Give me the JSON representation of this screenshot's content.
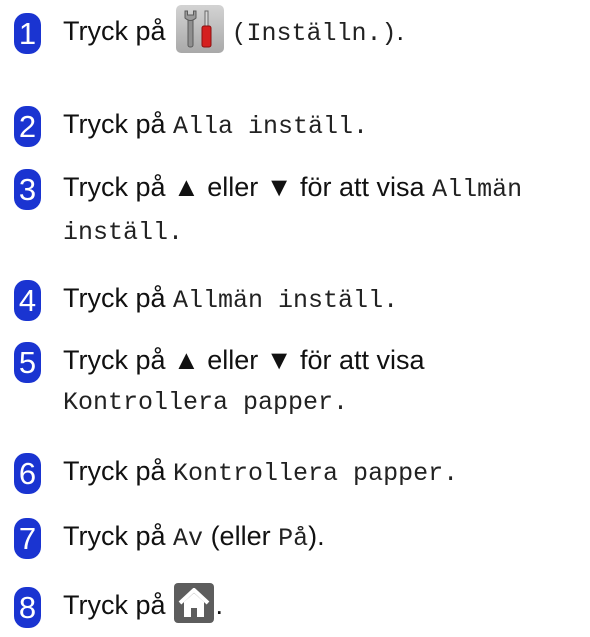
{
  "steps": [
    {
      "number": "1",
      "before": "Tryck på",
      "icon": "settings-tools-icon",
      "code": "(Inställn.)",
      "after": "."
    },
    {
      "number": "2",
      "before": "Tryck på",
      "code": "Alla inställ.",
      "after": ""
    },
    {
      "number": "3",
      "before": "Tryck på ▲ eller ▼ för att visa",
      "code1": "Allmän",
      "code2": "inställ.",
      "after": ""
    },
    {
      "number": "4",
      "before": "Tryck på",
      "code": "Allmän inställ.",
      "after": ""
    },
    {
      "number": "5",
      "before": "Tryck på ▲ eller ▼ för att visa",
      "code": "Kontrollera papper.",
      "after": ""
    },
    {
      "number": "6",
      "before": "Tryck på",
      "code": "Kontrollera papper.",
      "after": ""
    },
    {
      "number": "7",
      "before": "Tryck på",
      "code1": "Av",
      "mid": "(eller",
      "code2": "På",
      "after": ")."
    },
    {
      "number": "8",
      "before": "Tryck på",
      "icon": "home-icon",
      "after": "."
    }
  ],
  "colors": {
    "badge": "#1a34d1",
    "text": "#111111"
  }
}
